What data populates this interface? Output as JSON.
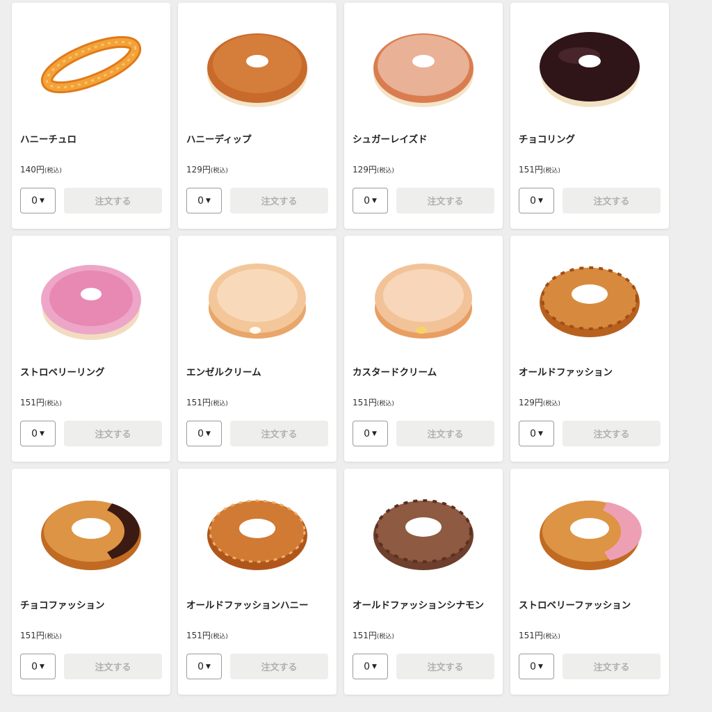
{
  "products": [
    {
      "name": "ハニーチュロ",
      "price": "140円",
      "tax_label": "(税込)",
      "quantity": "0",
      "order_label": "注文する",
      "image": "honey-churro"
    },
    {
      "name": "ハニーディップ",
      "price": "129円",
      "tax_label": "(税込)",
      "quantity": "0",
      "order_label": "注文する",
      "image": "honey-dip"
    },
    {
      "name": "シュガーレイズド",
      "price": "129円",
      "tax_label": "(税込)",
      "quantity": "0",
      "order_label": "注文する",
      "image": "sugar-raised"
    },
    {
      "name": "チョコリング",
      "price": "151円",
      "tax_label": "(税込)",
      "quantity": "0",
      "order_label": "注文する",
      "image": "choco-ring"
    },
    {
      "name": "ストロベリーリング",
      "price": "151円",
      "tax_label": "(税込)",
      "quantity": "0",
      "order_label": "注文する",
      "image": "strawberry-ring"
    },
    {
      "name": "エンゼルクリーム",
      "price": "151円",
      "tax_label": "(税込)",
      "quantity": "0",
      "order_label": "注文する",
      "image": "angel-cream"
    },
    {
      "name": "カスタードクリーム",
      "price": "151円",
      "tax_label": "(税込)",
      "quantity": "0",
      "order_label": "注文する",
      "image": "custard-cream"
    },
    {
      "name": "オールドファッション",
      "price": "129円",
      "tax_label": "(税込)",
      "quantity": "0",
      "order_label": "注文する",
      "image": "old-fashion"
    },
    {
      "name": "チョコファッション",
      "price": "151円",
      "tax_label": "(税込)",
      "quantity": "0",
      "order_label": "注文する",
      "image": "choco-fashion"
    },
    {
      "name": "オールドファッションハニー",
      "price": "151円",
      "tax_label": "(税込)",
      "quantity": "0",
      "order_label": "注文する",
      "image": "old-fashion-honey"
    },
    {
      "name": "オールドファッションシナモン",
      "price": "151円",
      "tax_label": "(税込)",
      "quantity": "0",
      "order_label": "注文する",
      "image": "old-fashion-cinnamon"
    },
    {
      "name": "ストロベリーファッション",
      "price": "151円",
      "tax_label": "(税込)",
      "quantity": "0",
      "order_label": "注文する",
      "image": "strawberry-fashion"
    }
  ],
  "colors": {
    "page_background": "#eeeeee",
    "card_background": "#ffffff",
    "order_button_background": "#eeeeec",
    "order_button_text": "#b0b0b0"
  }
}
